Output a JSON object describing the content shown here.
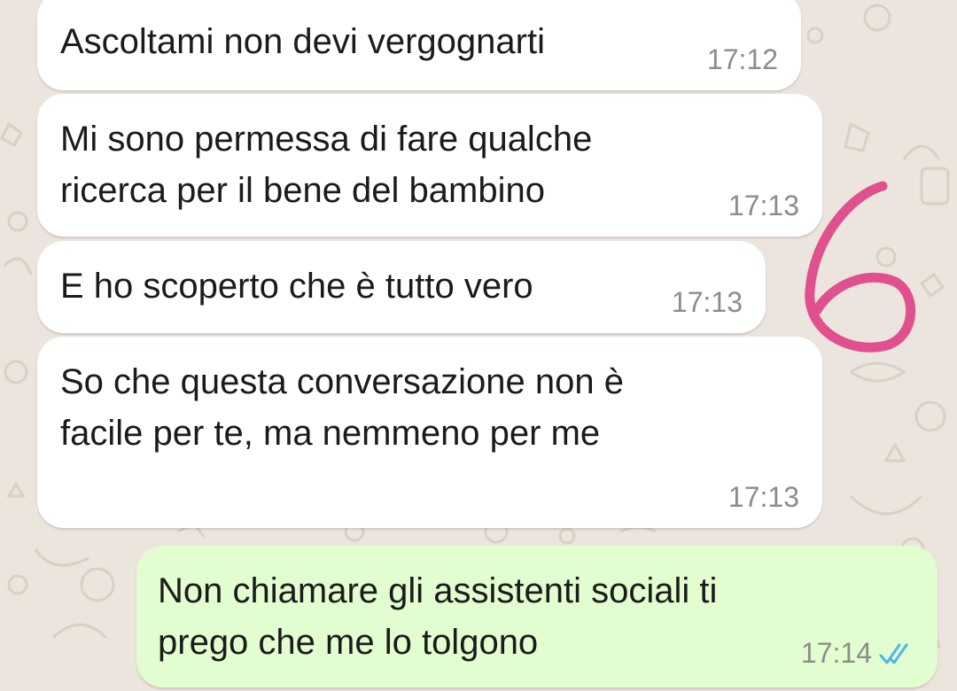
{
  "chat": {
    "messages": [
      {
        "direction": "incoming",
        "text": "Ascoltami non devi vergognarti",
        "time": "17:12"
      },
      {
        "direction": "incoming",
        "text": "Mi sono permessa di fare qualche\nricerca per il bene del bambino",
        "time": "17:13"
      },
      {
        "direction": "incoming",
        "text": "E ho scoperto che è tutto vero",
        "time": "17:13"
      },
      {
        "direction": "incoming",
        "text": "So che questa conversazione non è\nfacile per te, ma nemmeno per me",
        "time": "17:13"
      },
      {
        "direction": "outgoing",
        "text": "Non chiamare gli assistenti sociali ti\nprego che me lo tolgono",
        "time": "17:14",
        "status": "read",
        "status_icon": "double-check-icon"
      }
    ]
  },
  "annotation": {
    "text": "6",
    "color": "#e0508f"
  },
  "colors": {
    "background": "#ece5dd",
    "incoming_bubble": "#ffffff",
    "outgoing_bubble": "#e2fdd0",
    "read_ticks": "#4fb6ec"
  }
}
